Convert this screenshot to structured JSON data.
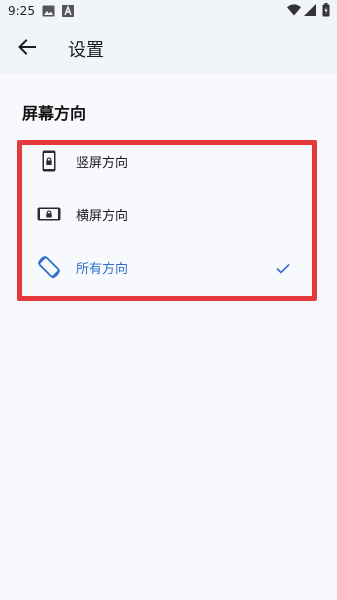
{
  "status_bar": {
    "time": "9:25",
    "icons": [
      "image-icon",
      "font-a-icon",
      "wifi-icon",
      "signal-icon",
      "battery-charging-icon"
    ]
  },
  "toolbar": {
    "title": "设置",
    "back_icon": "arrow-back-icon"
  },
  "section": {
    "heading": "屏幕方向",
    "options": [
      {
        "label": "竖屏方向",
        "icon": "portrait-lock-icon",
        "selected": false
      },
      {
        "label": "横屏方向",
        "icon": "landscape-lock-icon",
        "selected": false
      },
      {
        "label": "所有方向",
        "icon": "screen-rotation-icon",
        "selected": true
      }
    ]
  },
  "colors": {
    "accent": "#2f6fd0",
    "highlight_border": "#e53a3d",
    "background": "#f7f9fd",
    "toolbar_bg": "#f1f4f9"
  }
}
